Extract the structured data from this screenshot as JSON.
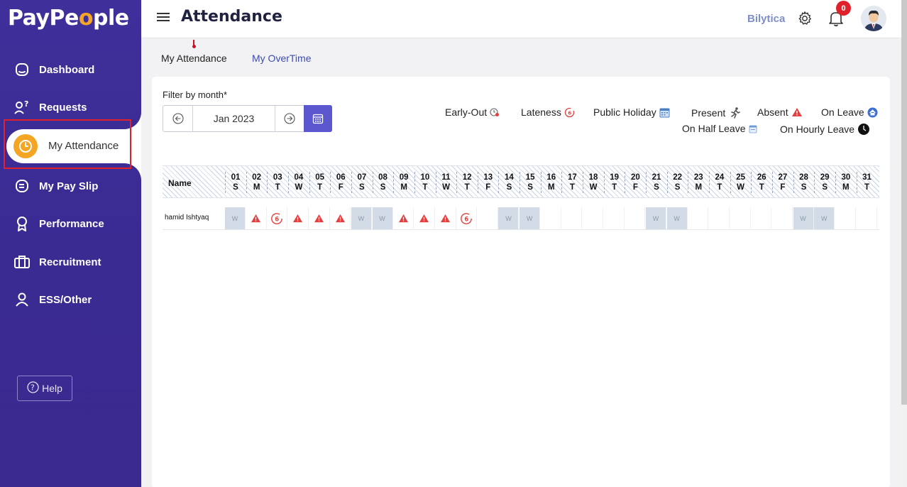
{
  "app": {
    "logo_part1": "PayPe",
    "logo_part2": "o",
    "logo_part3": "ple"
  },
  "sidebar": {
    "items": [
      {
        "label": "Dashboard",
        "icon": "home-icon"
      },
      {
        "label": "Requests",
        "icon": "requests-icon"
      },
      {
        "label": "My Attendance",
        "icon": "clock-icon",
        "active": true
      },
      {
        "label": "My Pay Slip",
        "icon": "payslip-icon"
      },
      {
        "label": "Performance",
        "icon": "award-icon"
      },
      {
        "label": "Recruitment",
        "icon": "briefcase-icon"
      },
      {
        "label": "ESS/Other",
        "icon": "user-icon"
      }
    ],
    "help_label": "Help"
  },
  "header": {
    "title": "Attendance",
    "company": "Bilytica",
    "notification_count": "0"
  },
  "tabs": [
    {
      "label": "My Attendance",
      "active": true
    },
    {
      "label": "My OverTime",
      "active": false
    }
  ],
  "filter": {
    "label": "Filter by month*",
    "month": "Jan 2023"
  },
  "legend": {
    "early_out": "Early-Out",
    "lateness": "Lateness",
    "public_holiday": "Public Holiday",
    "present": "Present",
    "absent": "Absent",
    "on_leave": "On Leave",
    "on_half_leave": "On Half Leave",
    "on_hourly_leave": "On Hourly Leave"
  },
  "colors": {
    "sidebar": "#3c2d96",
    "accent": "#f5a524",
    "primary": "#5b57cf",
    "absent": "#e53e3e",
    "weekend": "#d3dce6"
  },
  "table": {
    "name_header": "Name",
    "days": [
      {
        "d": "01",
        "w": "S"
      },
      {
        "d": "02",
        "w": "M"
      },
      {
        "d": "03",
        "w": "T"
      },
      {
        "d": "04",
        "w": "W"
      },
      {
        "d": "05",
        "w": "T"
      },
      {
        "d": "06",
        "w": "F"
      },
      {
        "d": "07",
        "w": "S"
      },
      {
        "d": "08",
        "w": "S"
      },
      {
        "d": "09",
        "w": "M"
      },
      {
        "d": "10",
        "w": "T"
      },
      {
        "d": "11",
        "w": "W"
      },
      {
        "d": "12",
        "w": "T"
      },
      {
        "d": "13",
        "w": "F"
      },
      {
        "d": "14",
        "w": "S"
      },
      {
        "d": "15",
        "w": "S"
      },
      {
        "d": "16",
        "w": "M"
      },
      {
        "d": "17",
        "w": "T"
      },
      {
        "d": "18",
        "w": "W"
      },
      {
        "d": "19",
        "w": "T"
      },
      {
        "d": "20",
        "w": "F"
      },
      {
        "d": "21",
        "w": "S"
      },
      {
        "d": "22",
        "w": "S"
      },
      {
        "d": "23",
        "w": "M"
      },
      {
        "d": "24",
        "w": "T"
      },
      {
        "d": "25",
        "w": "W"
      },
      {
        "d": "26",
        "w": "T"
      },
      {
        "d": "27",
        "w": "F"
      },
      {
        "d": "28",
        "w": "S"
      },
      {
        "d": "29",
        "w": "S"
      },
      {
        "d": "30",
        "w": "M"
      },
      {
        "d": "31",
        "w": "T"
      }
    ],
    "rows": [
      {
        "name": "hamid Ishtyaq",
        "weekend_label": "W",
        "lateness_count": "6",
        "cells": [
          "weekend",
          "absent",
          "late",
          "absent",
          "absent",
          "absent",
          "weekend",
          "weekend",
          "absent",
          "absent",
          "absent",
          "late",
          "empty",
          "weekend",
          "weekend",
          "empty",
          "empty",
          "empty",
          "empty",
          "empty",
          "weekend",
          "weekend",
          "empty",
          "empty",
          "empty",
          "empty",
          "empty",
          "weekend",
          "weekend",
          "empty",
          "empty"
        ]
      }
    ]
  }
}
